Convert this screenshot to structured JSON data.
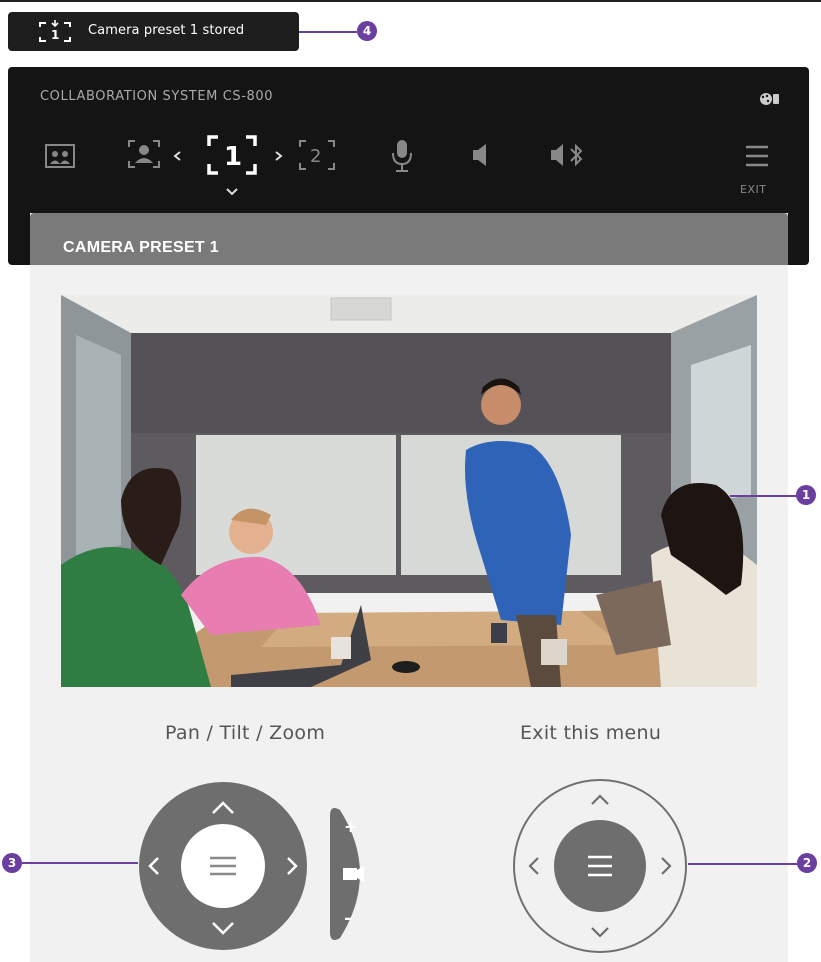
{
  "toast": {
    "icon": "camera-preset-1-icon",
    "message": "Camera preset 1 stored"
  },
  "callouts": {
    "c1": "1",
    "c2": "2",
    "c3": "3",
    "c4": "4"
  },
  "controlbar": {
    "title": "COLLABORATION SYSTEM CS-800",
    "icons": [
      "layout-icon",
      "speaker-track-icon",
      "preset-prev-icon",
      "preset-1-icon",
      "preset-next-icon",
      "preset-2-icon",
      "microphone-icon",
      "volume-icon",
      "bluetooth-audio-icon",
      "menu-icon",
      "status-icon"
    ],
    "exit_label": "EXIT"
  },
  "panel": {
    "title": "CAMERA PRESET 1",
    "ptz_label": "Pan / Tilt / Zoom",
    "exit_label": "Exit this menu",
    "zoom_in": "+",
    "zoom_out": "–"
  },
  "colors": {
    "callout": "#6b3fa0",
    "bar": "#141414",
    "panel_header": "#7a7a7a",
    "dpad": "#6e6e6e"
  }
}
